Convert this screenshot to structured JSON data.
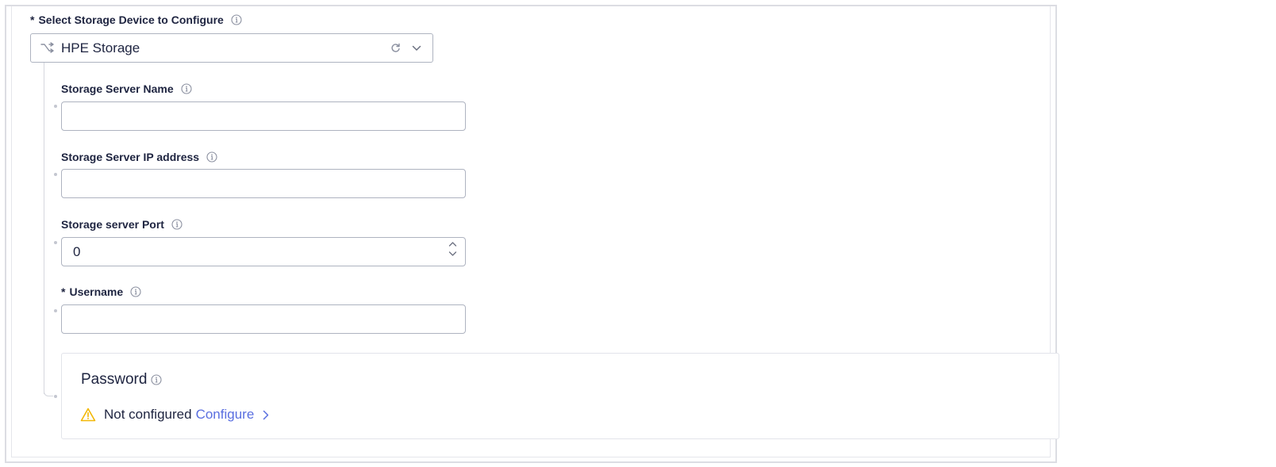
{
  "device_selector": {
    "label": "Select Storage Device to Configure",
    "required_marker": "*",
    "selected_value": "HPE Storage"
  },
  "fields": {
    "server_name": {
      "label": "Storage Server Name",
      "value": ""
    },
    "server_ip": {
      "label": "Storage Server IP address",
      "value": ""
    },
    "server_port": {
      "label": "Storage server Port",
      "value": "0"
    },
    "username": {
      "label": "Username",
      "required_marker": "*",
      "value": ""
    }
  },
  "password": {
    "title": "Password",
    "status": "Not configured",
    "action_label": "Configure"
  },
  "icons": {
    "info": "info-icon",
    "device": "branch-icon",
    "refresh": "refresh-icon",
    "dropdown": "chevron-down-icon",
    "warning": "warning-icon",
    "link_arrow": "chevron-right-icon"
  },
  "colors": {
    "label_text": "#1e2440",
    "input_border": "#aeb3c0",
    "link": "#5a6fe0",
    "warning": "#f2b705",
    "icon_gray": "#8b90a0"
  }
}
